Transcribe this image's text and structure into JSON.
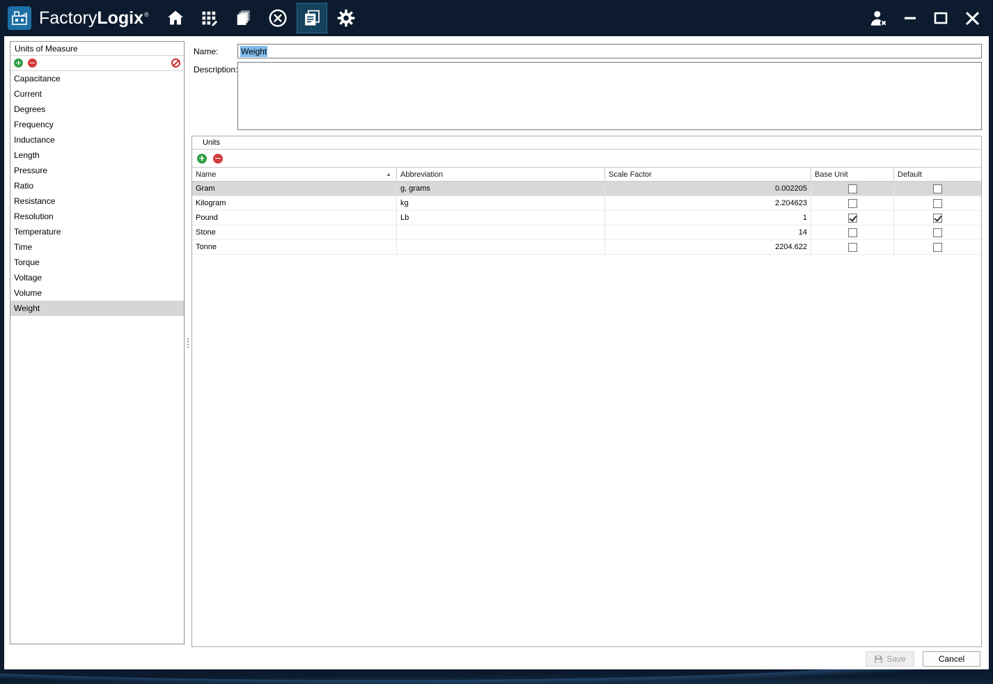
{
  "titlebar": {
    "brand_factory": "Factory",
    "brand_logix": "Logix",
    "brand_registered": "®"
  },
  "sidebar": {
    "header": "Units of Measure",
    "items": [
      "Capacitance",
      "Current",
      "Degrees",
      "Frequency",
      "Inductance",
      "Length",
      "Pressure",
      "Ratio",
      "Resistance",
      "Resolution",
      "Temperature",
      "Time",
      "Torque",
      "Voltage",
      "Volume",
      "Weight"
    ],
    "selected_item": "Weight"
  },
  "detail": {
    "name_label": "Name:",
    "name_value": "Weight",
    "description_label": "Description:",
    "description_value": "",
    "units": {
      "header": "Units",
      "columns": [
        "Name",
        "Abbreviation",
        "Scale Factor",
        "Base Unit",
        "Default"
      ],
      "rows": [
        {
          "name": "Gram",
          "abbreviation": "g, grams",
          "scale_factor": "0.002205",
          "base_unit": false,
          "default": false
        },
        {
          "name": "Kilogram",
          "abbreviation": "kg",
          "scale_factor": "2.204623",
          "base_unit": false,
          "default": false
        },
        {
          "name": "Pound",
          "abbreviation": "Lb",
          "scale_factor": "1",
          "base_unit": true,
          "default": true
        },
        {
          "name": "Stone",
          "abbreviation": "",
          "scale_factor": "14",
          "base_unit": false,
          "default": false
        },
        {
          "name": "Tonne",
          "abbreviation": "",
          "scale_factor": "2204.622",
          "base_unit": false,
          "default": false
        }
      ],
      "selected_row": "Gram",
      "sort": {
        "column": "Name",
        "direction": "ascending",
        "glyph": "▲"
      }
    }
  },
  "footer": {
    "save_label": "Save",
    "cancel_label": "Cancel"
  },
  "colors": {
    "titlebar": "#0c1b2e",
    "selection_highlight": "#0078d7",
    "row_selected": "#d8d8d8",
    "list_selected": "#d6d6d6",
    "add_icon_green": "#2f9e44",
    "remove_icon_red": "#d23b3b"
  }
}
